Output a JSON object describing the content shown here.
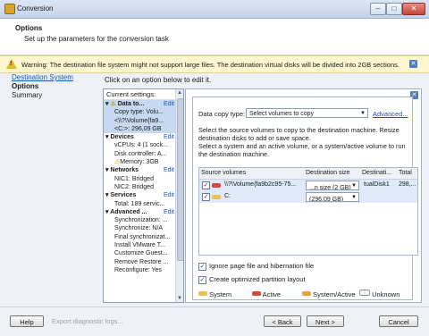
{
  "window": {
    "title": "Conversion"
  },
  "header": {
    "title": "Options",
    "subtitle": "Set up the parameters for the conversion task"
  },
  "warning": {
    "text": "Warning: The destination file system might not support large files. The destination virtual disks will be divided into 2GB sections."
  },
  "nav": {
    "items": [
      "Destination System",
      "Options",
      "Summary"
    ]
  },
  "instruction": "Click on an option below to edit it.",
  "settings": {
    "header": "Current settings:",
    "edit_label": "Edit",
    "groups": [
      {
        "title": "Data to...",
        "items": [
          "Copy type: Volu...",
          "<\\\\?\\Volume{fa9...",
          "<C:>: 296,09 GB"
        ]
      },
      {
        "title": "Devices",
        "items": [
          "vCPUs: 4 (1 sock...",
          "Disk controller: A...",
          "Memory: 3GB"
        ]
      },
      {
        "title": "Networks",
        "items": [
          "NIC1: Bridged",
          "NIC2: Bridged"
        ]
      },
      {
        "title": "Services",
        "items": [
          "Total: 189 servic..."
        ]
      },
      {
        "title": "Advanced ...",
        "items": [
          "Synchronization: ...",
          "Synchronize: N/A",
          "Final synchronizat...",
          "Install VMware T...",
          "Customize Guest...",
          "Remove Restore ...",
          "Reconfigure: Yes"
        ]
      }
    ]
  },
  "panel": {
    "copy_type_label": "Data copy type:",
    "copy_type_value": "Select volumes to copy",
    "advanced_link": "Advanced...",
    "desc1": "Select the source volumes to copy to the destination machine. Resize destination disks to add or save space.",
    "desc2": "Select a system and an active volume, or a system/active volume to run the destination machine.",
    "table": {
      "columns": [
        "Source volumes",
        "Destination size",
        "Destinati...",
        "Total"
      ],
      "rows": [
        {
          "name": "\\\\?\\Volume{fa9b2c95-75...",
          "size": "...n size (2 GB)",
          "dest": "tualDisk1",
          "total": "298,..."
        },
        {
          "name": "C:",
          "size": "(296,09 GB)",
          "dest": "",
          "total": ""
        }
      ]
    },
    "ignore_pagefile": "Ignore page file and hibernation file",
    "optimized_layout": "Create optimized partition layout",
    "legend": [
      "System",
      "Active",
      "System/Active",
      "Unknown"
    ]
  },
  "footer": {
    "help": "Help",
    "export": "Export diagnostic logs...",
    "back": "< Back",
    "next": "Next >",
    "cancel": "Cancel"
  },
  "colors": {
    "system": "#e8c352",
    "active": "#d8473c",
    "system_active": "#e8a23c",
    "unknown": "#f2f2f2"
  }
}
